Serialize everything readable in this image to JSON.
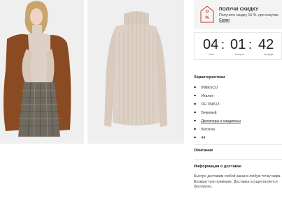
{
  "promo": {
    "title": "ПОЛУЧИ СКИДКУ",
    "text": "Получите скидку 15 %, при покупке",
    "link": "Сумки"
  },
  "timer": {
    "hours": "04",
    "minutes": "01",
    "seconds": "42",
    "hours_label": "часа",
    "minutes_label": "минуты",
    "seconds_label": "секунды",
    "separator": ":"
  },
  "characteristics": {
    "title": "Характеристики",
    "items": [
      {
        "text": "INNESCO",
        "link": false
      },
      {
        "text": "Италия",
        "link": false
      },
      {
        "text": "DF-784513",
        "link": false
      },
      {
        "text": "Бежевый",
        "link": false
      },
      {
        "text": "Джемперы и кардиганы",
        "link": true
      },
      {
        "text": "Вискоза",
        "link": false
      },
      {
        "text": "44",
        "link": false
      }
    ]
  },
  "description": {
    "title": "Описание"
  },
  "delivery": {
    "title": "Информация о доставке",
    "text": "Быстро доставим любой заказ в любую точку мира. Возврат при примерке. Доставка осуществляется бесплатно."
  },
  "colors": {
    "photo_bg": "#efefef",
    "sweater": "#ddd0c4",
    "coat": "#8a4a22",
    "skirt": "#6f6a60"
  }
}
